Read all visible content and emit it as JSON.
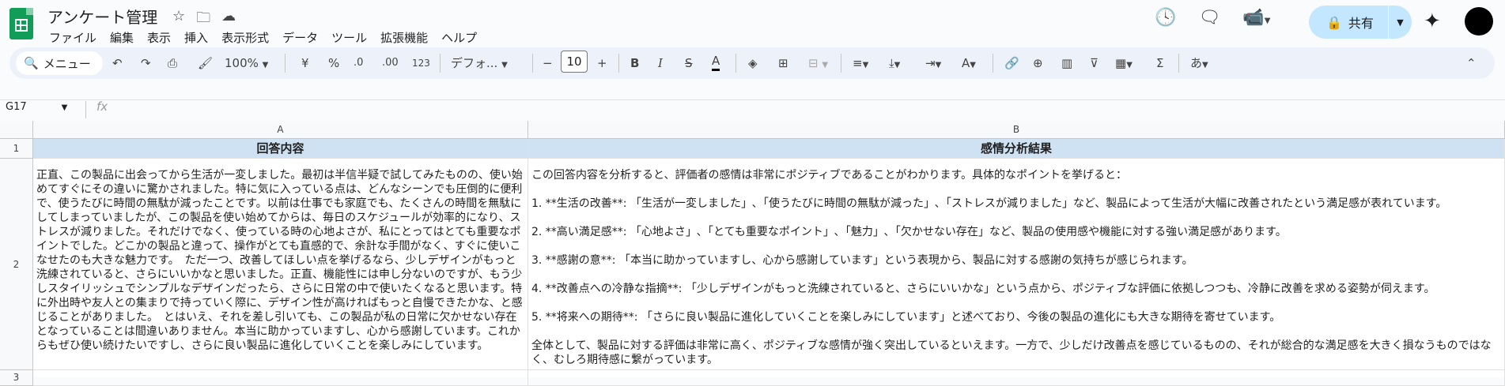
{
  "doc": {
    "title": "アンケート管理"
  },
  "menu": [
    "ファイル",
    "編集",
    "表示",
    "挿入",
    "表示形式",
    "データ",
    "ツール",
    "拡張機能",
    "ヘルプ"
  ],
  "header": {
    "share_label": "共有"
  },
  "toolbar": {
    "search_label": "メニュー",
    "zoom": "100%",
    "currency": "¥",
    "percent": "%",
    "dec_less": ".0",
    "dec_more": ".00",
    "number_format": "123",
    "font": "デフォ...",
    "font_size": "10",
    "input_tools": "あ"
  },
  "formula_bar": {
    "name_box": "G17",
    "fx_label": "fx"
  },
  "grid": {
    "columns": [
      "A",
      "B"
    ],
    "rows": [
      "1",
      "2",
      "3"
    ],
    "header_a": "回答内容",
    "header_b": "感情分析結果",
    "a2": "正直、この製品に出会ってから生活が一変しました。最初は半信半疑で試してみたものの、使い始めてすぐにその違いに驚かされました。特に気に入っている点は、どんなシーンでも圧倒的に便利で、使うたびに時間の無駄が減ったことです。以前は仕事でも家庭でも、たくさんの時間を無駄にしてしまっていましたが、この製品を使い始めてからは、毎日のスケジュールが効率的になり、ストレスが減りました。それだけでなく、使っている時の心地よさが、私にとってはとても重要なポイントでした。どこかの製品と違って、操作がとても直感的で、余計な手間がなく、すぐに使いこなせたのも大きな魅力です。　ただ一つ、改善してほしい点を挙げるなら、少しデザインがもっと洗練されていると、さらにいいかなと思いました。正直、機能性には申し分ないのですが、もう少しスタイリッシュでシンプルなデザインだったら、さらに日常の中で使いたくなると思います。特に外出時や友人との集まりで持っていく際に、デザイン性が高ければもっと自慢できたかな、と感じることがありました。　とはいえ、それを差し引いても、この製品が私の日常に欠かせない存在となっていることは間違いありません。本当に助かっていますし、心から感謝しています。これからもぜひ使い続けたいですし、さらに良い製品に進化していくことを楽しみにしています。",
    "b2": "この回答内容を分析すると、評価者の感情は非常にポジティブであることがわかります。具体的なポイントを挙げると：\n\n1. **生活の改善**: 「生活が一変しました」､「使うたびに時間の無駄が減った」､「ストレスが減りました」など、製品によって生活が大幅に改善されたという満足感が表れています。\n\n2. **高い満足感**: 「心地よさ」､「とても重要なポイント」､「魅力」､「欠かせない存在」など、製品の使用感や機能に対する強い満足感があります。\n\n3. **感謝の意**: 「本当に助かっていますし、心から感謝しています」という表現から、製品に対する感謝の気持ちが感じられます。\n\n4. **改善点への冷静な指摘**: 「少しデザインがもっと洗練されていると、さらにいいかな」という点から、ポジティブな評価に依拠しつつも、冷静に改善を求める姿勢が伺えます。\n\n5. **将来への期待**: 「さらに良い製品に進化していくことを楽しみにしています」と述べており、今後の製品の進化にも大きな期待を寄せています。\n\n全体として、製品に対する評価は非常に高く、ポジティブな感情が強く突出しているといえます。一方で、少しだけ改善点を感じているものの、それが総合的な満足感を大きく損なうものではなく、むしろ期待感に繋がっています。"
  }
}
